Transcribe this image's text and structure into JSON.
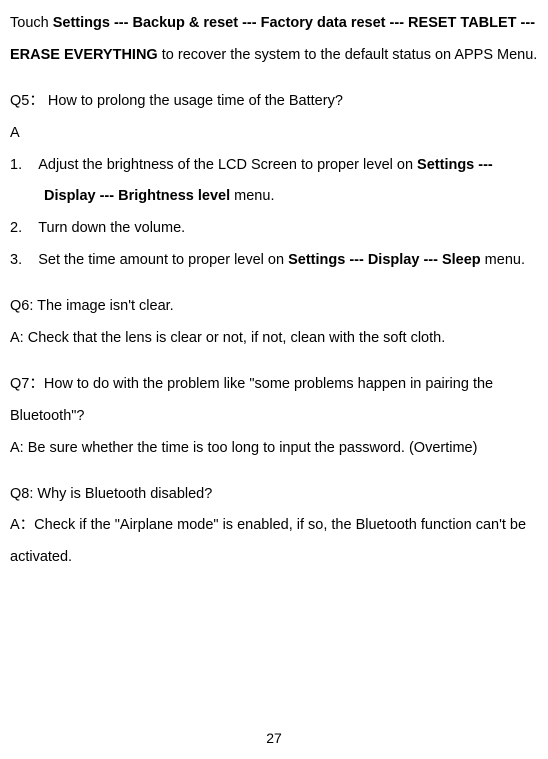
{
  "intro": {
    "prefix": "Touch ",
    "path": "Settings --- Backup & reset --- Factory data reset --- RESET TABLET --- ERASE EVERYTHING",
    "suffix": " to recover the system to the default status on APPS Menu."
  },
  "q5": {
    "question": "Q5： How to prolong the usage time of the Battery?",
    "answer_label": "A",
    "items": [
      {
        "num": "1.",
        "text_before": "Adjust the brightness of the LCD Screen to proper level on ",
        "bold": "Settings --- Display --- Brightness level",
        "text_after": " menu."
      },
      {
        "num": "2.",
        "text_before": "Turn down the volume.",
        "bold": "",
        "text_after": ""
      },
      {
        "num": "3.",
        "text_before": "Set the time amount to proper level on ",
        "bold": "Settings --- Display --- Sleep",
        "text_after": " menu."
      }
    ]
  },
  "q6": {
    "question": "Q6: The image isn't clear.",
    "answer": "A: Check that the lens is clear or not, if not, clean with the soft cloth."
  },
  "q7": {
    "question": "Q7：How to do with the problem like \"some problems happen in pairing the Bluetooth\"?",
    "answer": "A: Be sure whether the time is too long to input the password. (Overtime)"
  },
  "q8": {
    "question": "Q8: Why is Bluetooth disabled?",
    "answer": "A：Check if the \"Airplane mode\" is enabled, if so, the Bluetooth function can't be activated."
  },
  "page_number": "27"
}
